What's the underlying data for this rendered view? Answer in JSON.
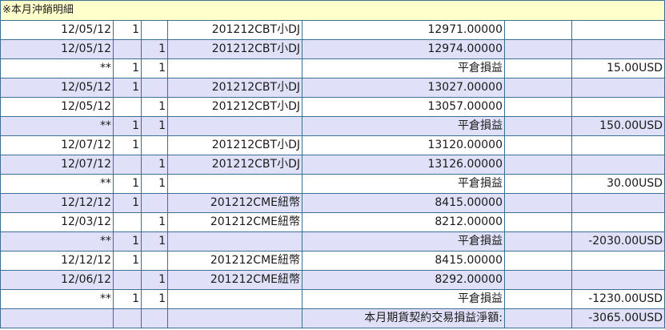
{
  "title": "※本月沖銷明細",
  "rows": [
    {
      "date": "12/05/12",
      "buy": "1",
      "sell": "",
      "product": "201212CBT小DJ",
      "price": "12971.00000",
      "note": "",
      "pnl": ""
    },
    {
      "date": "12/05/12",
      "buy": "",
      "sell": "1",
      "product": "201212CBT小DJ",
      "price": "12974.00000",
      "note": "",
      "pnl": ""
    },
    {
      "date": "**",
      "buy": "1",
      "sell": "1",
      "product": "",
      "price": "平倉損益",
      "note": "",
      "pnl": "15.00USD"
    },
    {
      "date": "12/05/12",
      "buy": "1",
      "sell": "",
      "product": "201212CBT小DJ",
      "price": "13027.00000",
      "note": "",
      "pnl": ""
    },
    {
      "date": "12/05/12",
      "buy": "",
      "sell": "1",
      "product": "201212CBT小DJ",
      "price": "13057.00000",
      "note": "",
      "pnl": ""
    },
    {
      "date": "**",
      "buy": "1",
      "sell": "1",
      "product": "",
      "price": "平倉損益",
      "note": "",
      "pnl": "150.00USD"
    },
    {
      "date": "12/07/12",
      "buy": "1",
      "sell": "",
      "product": "201212CBT小DJ",
      "price": "13120.00000",
      "note": "",
      "pnl": ""
    },
    {
      "date": "12/07/12",
      "buy": "",
      "sell": "1",
      "product": "201212CBT小DJ",
      "price": "13126.00000",
      "note": "",
      "pnl": ""
    },
    {
      "date": "**",
      "buy": "1",
      "sell": "1",
      "product": "",
      "price": "平倉損益",
      "note": "",
      "pnl": "30.00USD"
    },
    {
      "date": "12/12/12",
      "buy": "1",
      "sell": "",
      "product": "201212CME紐幣",
      "price": "8415.00000",
      "note": "",
      "pnl": ""
    },
    {
      "date": "12/03/12",
      "buy": "",
      "sell": "1",
      "product": "201212CME紐幣",
      "price": "8212.00000",
      "note": "",
      "pnl": ""
    },
    {
      "date": "**",
      "buy": "1",
      "sell": "1",
      "product": "",
      "price": "平倉損益",
      "note": "",
      "pnl": "-2030.00USD"
    },
    {
      "date": "12/12/12",
      "buy": "1",
      "sell": "",
      "product": "201212CME紐幣",
      "price": "8415.00000",
      "note": "",
      "pnl": ""
    },
    {
      "date": "12/06/12",
      "buy": "",
      "sell": "1",
      "product": "201212CME紐幣",
      "price": "8292.00000",
      "note": "",
      "pnl": ""
    },
    {
      "date": "**",
      "buy": "1",
      "sell": "1",
      "product": "",
      "price": "平倉損益",
      "note": "",
      "pnl": "-1230.00USD"
    },
    {
      "date": "",
      "buy": "",
      "sell": "",
      "product": "",
      "price": "本月期貨契約交易損益淨額:",
      "note": "",
      "pnl": "-3065.00USD"
    }
  ],
  "colors": {
    "title_bg": "#ffffcc",
    "alt_row": "#e0e0f8",
    "border": "#3e6f93"
  }
}
